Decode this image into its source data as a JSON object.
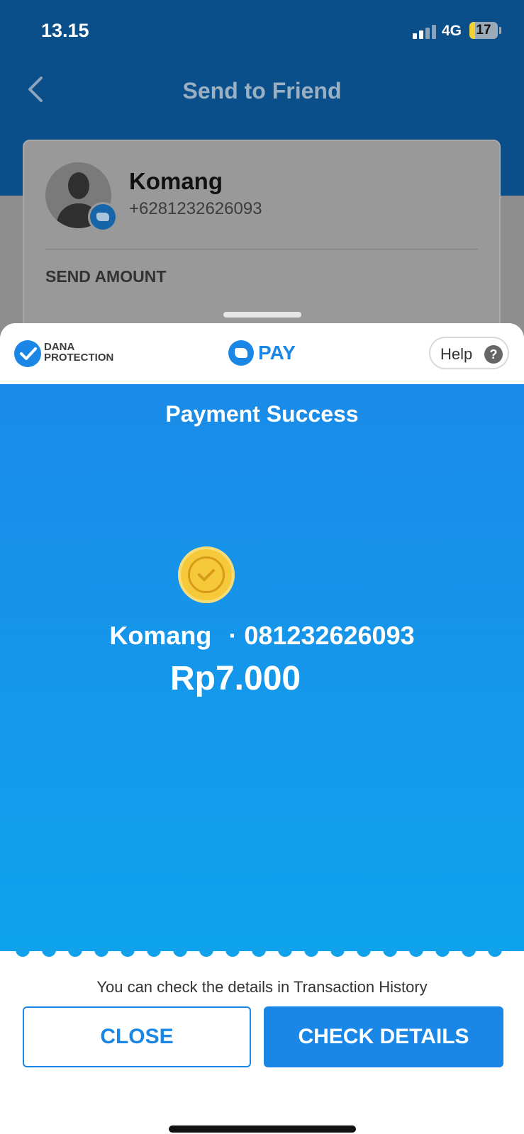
{
  "status_bar": {
    "time": "13.15",
    "network": "4G",
    "battery": "17"
  },
  "nav": {
    "title": "Send to Friend"
  },
  "contact": {
    "name": "Komang",
    "phone": "+6281232626093",
    "send_amount_label": "SEND AMOUNT"
  },
  "sheet_header": {
    "protection_line1": "DANA",
    "protection_line2": "PROTECTION",
    "pay_label": "PAY",
    "help_label": "Help",
    "help_icon": "?"
  },
  "result": {
    "title": "Payment Success",
    "recipient_name": "Komang",
    "separator": "·",
    "recipient_number": "081232626093",
    "amount": "Rp7.000"
  },
  "footer": {
    "note": "You can check the details in Transaction History",
    "close_label": "CLOSE",
    "check_details_label": "CHECK DETAILS"
  },
  "colors": {
    "accent": "#1a86e6",
    "header_bg": "#0b4f8a",
    "coin": "#f5c93a"
  }
}
